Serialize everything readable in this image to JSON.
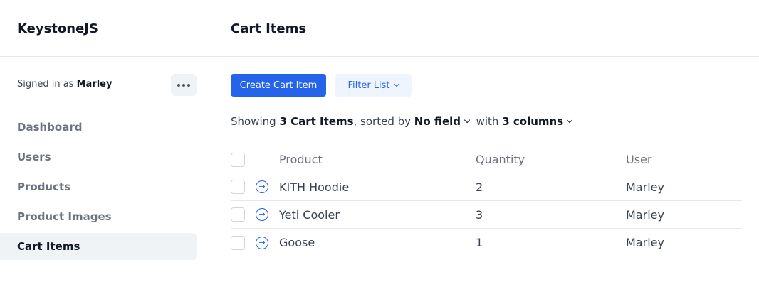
{
  "app": {
    "brand": "KeystoneJS"
  },
  "header": {
    "title": "Cart Items"
  },
  "sidebar": {
    "signed_in_prefix": "Signed in as",
    "user_name": "Marley",
    "items": [
      {
        "label": "Dashboard"
      },
      {
        "label": "Users"
      },
      {
        "label": "Products"
      },
      {
        "label": "Product Images"
      },
      {
        "label": "Cart Items",
        "active": true
      }
    ]
  },
  "toolbar": {
    "create_label": "Create Cart Item",
    "filter_label": "Filter List"
  },
  "summary": {
    "prefix": "Showing",
    "count": "3 Cart Items",
    "sorted_by": ", sorted by",
    "sort_field": "No field",
    "with": "with",
    "columns": "3 columns"
  },
  "table": {
    "headers": {
      "product": "Product",
      "quantity": "Quantity",
      "user": "User"
    },
    "rows": [
      {
        "product": "KITH Hoodie",
        "quantity": "2",
        "user": "Marley"
      },
      {
        "product": "Yeti Cooler",
        "quantity": "3",
        "user": "Marley"
      },
      {
        "product": "Goose",
        "quantity": "1",
        "user": "Marley"
      }
    ]
  },
  "colors": {
    "accent": "#2563eb",
    "sidebar_active_bg": "#eff3f6"
  }
}
